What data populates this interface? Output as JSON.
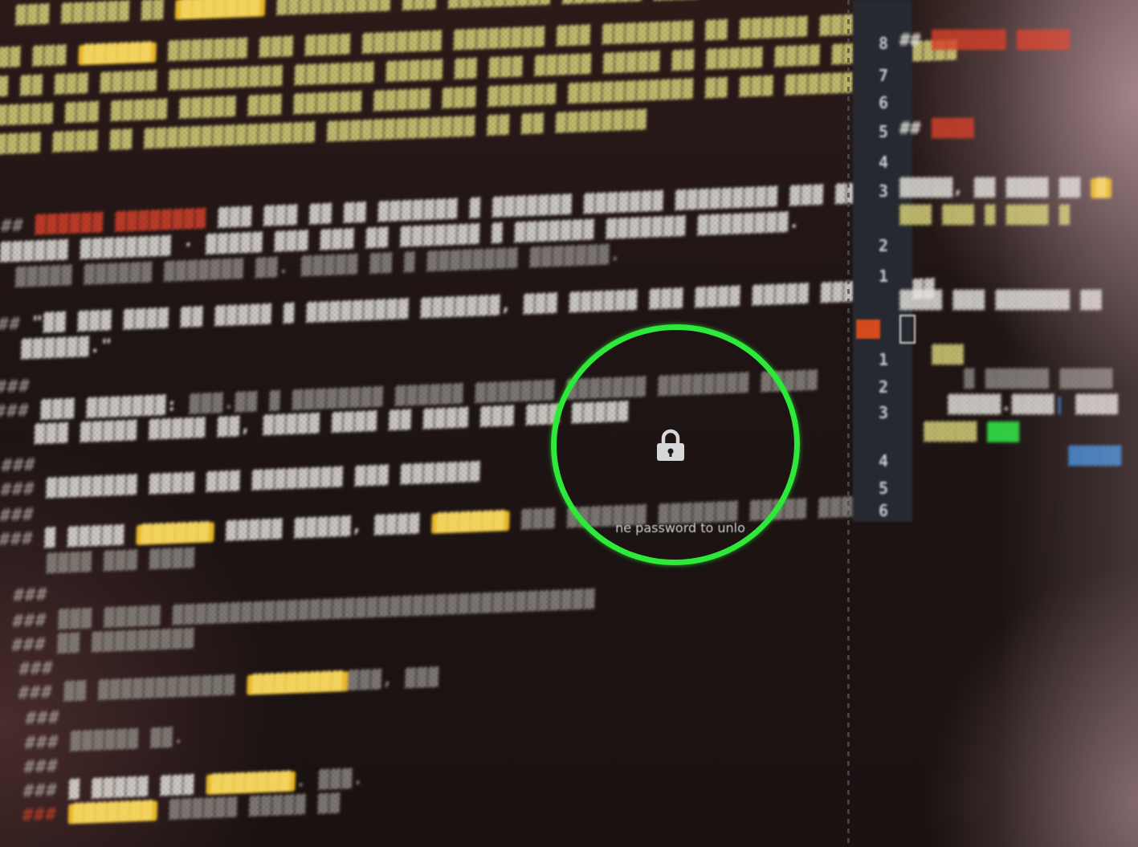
{
  "screen": {
    "type": "locked-terminal-editor-photo",
    "accent_ring_color": "#2ee83a",
    "highlight_color": "#e8b728"
  },
  "lock": {
    "icon": "lock-icon",
    "prompt_text": "ne password to unlo"
  },
  "right_gutter": {
    "line_numbers": [
      "8",
      "7",
      "6",
      "5",
      "4",
      "3",
      "2",
      "1",
      "1",
      "2",
      "3",
      "4",
      "5",
      "6"
    ]
  }
}
